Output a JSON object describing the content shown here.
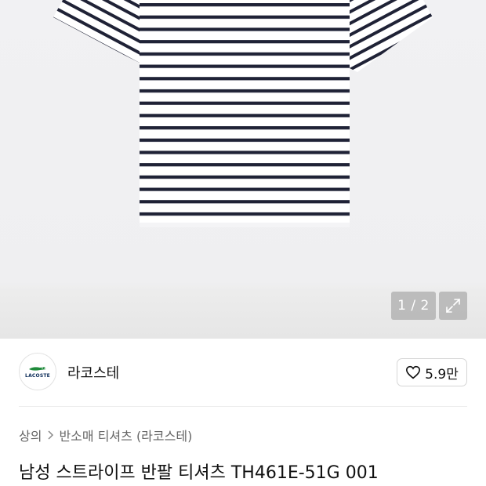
{
  "gallery": {
    "counter": "1 / 2",
    "expand_icon": "expand-arrows-icon"
  },
  "brand": {
    "logo_text": "LACOSTE",
    "name": "라코스테"
  },
  "like": {
    "icon": "heart-outline-icon",
    "count": "5.9만"
  },
  "breadcrumb": {
    "items": [
      "상의",
      "반소매 티셔츠 (라코스테)"
    ],
    "separator_icon": "chevron-right-icon"
  },
  "product": {
    "title": "남성 스트라이프 반팔 티셔츠 TH461E-51G 001"
  },
  "colors": {
    "stripe": "#1f2236",
    "shirt_base": "#ffffff",
    "background": "#efeff1"
  }
}
